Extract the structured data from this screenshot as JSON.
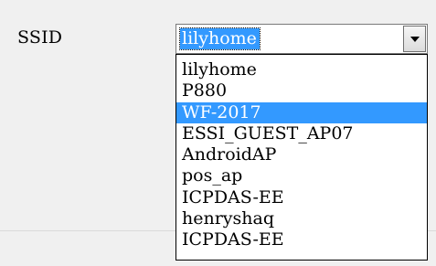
{
  "form": {
    "ssid_label": "SSID"
  },
  "ssid_select": {
    "value": "lilyhome",
    "options": [
      "lilyhome",
      "P880",
      "WF-2017",
      "ESSI_GUEST_AP07",
      "AndroidAP",
      "pos_ap",
      "ICPDAS-EE",
      "henryshaq",
      "ICPDAS-EE"
    ],
    "highlighted_option": "WF-2017",
    "dropdown_icon": "chevron-down-icon",
    "colors": {
      "highlight": "#3399ff",
      "highlight_text": "#ffffff"
    }
  }
}
